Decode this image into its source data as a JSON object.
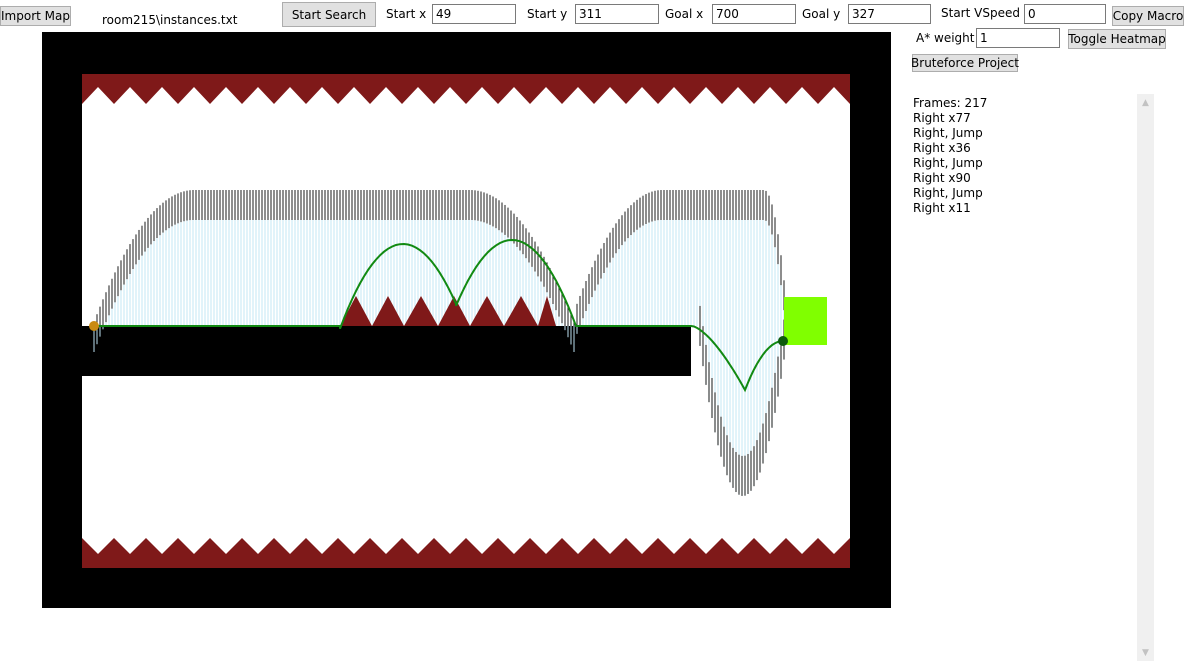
{
  "toolbar": {
    "import_label": "Import Map",
    "file_path": "room215\\instances.txt",
    "start_search_label": "Start Search",
    "copy_macro_label": "Copy Macro",
    "toggle_heatmap_label": "Toggle Heatmap",
    "bruteforce_label": "Bruteforce Project"
  },
  "fields": {
    "start_x": {
      "label": "Start x",
      "value": "49"
    },
    "start_y": {
      "label": "Start y",
      "value": "311"
    },
    "goal_x": {
      "label": "Goal x",
      "value": "700"
    },
    "goal_y": {
      "label": "Goal y",
      "value": "327"
    },
    "start_vspeed": {
      "label": "Start VSpeed",
      "value": "0"
    },
    "astar_weight": {
      "label": "A* weight",
      "value": "1"
    }
  },
  "output": {
    "lines": [
      "Frames: 217",
      "Right x77",
      "Right, Jump",
      "Right x36",
      "Right, Jump",
      "Right x90",
      "Right, Jump",
      "Right x11"
    ]
  },
  "colors": {
    "wall": "#000000",
    "spike": "#7f1919",
    "path": "#128a12",
    "start_marker": "#c98a12",
    "end_marker": "#0c5a0c",
    "goal": "#80ff00",
    "heatmap_light": "#bfe6f5",
    "heatmap_dark": "#303030"
  },
  "icons": {
    "scroll_up": "▲",
    "scroll_down": "▼"
  }
}
